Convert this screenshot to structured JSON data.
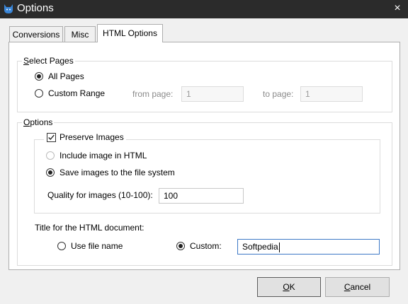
{
  "window": {
    "title": "Options",
    "close_icon": "×"
  },
  "tabs": [
    {
      "label": "Conversions",
      "active": false
    },
    {
      "label": "Misc",
      "active": false
    },
    {
      "label": "HTML Options",
      "active": true
    }
  ],
  "select_pages": {
    "legend_first": "S",
    "legend_rest": "elect Pages",
    "all_pages_label": "All Pages",
    "all_pages_selected": true,
    "custom_range_label": "Custom Range",
    "custom_range_selected": false,
    "from_page_label": "from page:",
    "from_page_value": "1",
    "to_page_label": "to page:",
    "to_page_value": "1"
  },
  "options": {
    "legend_first": "O",
    "legend_rest": "ptions",
    "preserve_images_label": "Preserve Images",
    "preserve_images_checked": true,
    "include_image_label": "Include image in HTML",
    "save_images_label": "Save images to the file system",
    "save_images_selected": true,
    "quality_label": "Quality for images (10-100):",
    "quality_value": "100",
    "title_doc_label": "Title for the HTML document:",
    "use_file_name_label": "Use file name",
    "custom_label": "Custom:",
    "custom_selected": true,
    "custom_value": "Softpedia"
  },
  "buttons": {
    "ok_first": "O",
    "ok_rest": "K",
    "cancel_first": "C",
    "cancel_rest": "ancel"
  },
  "colors": {
    "titlebar": "#2b2b2b",
    "panel": "#ffffff",
    "dialog": "#f0f0f0",
    "focus": "#3c78c6"
  }
}
